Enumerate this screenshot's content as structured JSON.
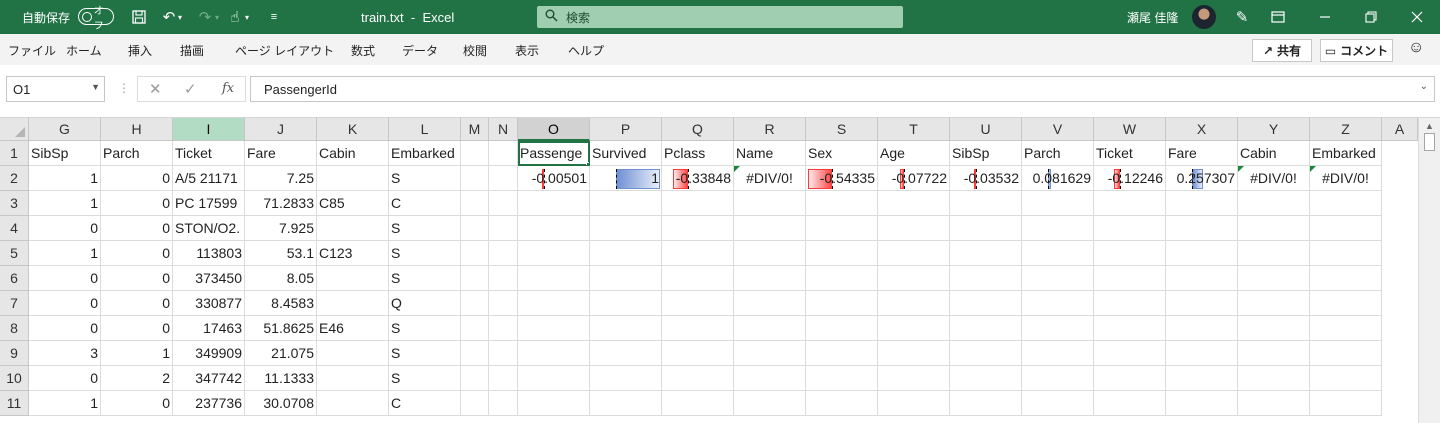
{
  "titlebar": {
    "autosave_label": "自動保存",
    "autosave_state": "オフ",
    "filename": "train.txt",
    "separator": "-",
    "app_name": "Excel",
    "search_placeholder": "検索",
    "user_name": "瀬尾 佳隆",
    "accent_color": "#217346"
  },
  "menu": {
    "items": [
      "ファイル",
      "ホーム",
      "挿入",
      "描画",
      "ページ レイアウト",
      "数式",
      "データ",
      "校閲",
      "表示",
      "ヘルプ"
    ],
    "share_label": "共有",
    "comment_label": "コメント"
  },
  "formula_bar": {
    "name_box": "O1",
    "fx_label": "fx",
    "formula": "PassengerId"
  },
  "sheet": {
    "columns": [
      "G",
      "H",
      "I",
      "J",
      "K",
      "L",
      "M",
      "N",
      "O",
      "P",
      "Q",
      "R",
      "S",
      "T",
      "U",
      "V",
      "W",
      "X",
      "Y",
      "Z",
      "A"
    ],
    "rows": [
      "1",
      "2",
      "3",
      "4",
      "5",
      "6",
      "7",
      "8",
      "9",
      "10",
      "11"
    ],
    "cells": [
      [
        "SibSp",
        "Parch",
        "Ticket",
        "Fare",
        "Cabin",
        "Embarked",
        "",
        "",
        "Passenge",
        "Survived",
        "Pclass",
        "Name",
        "Sex",
        "Age",
        "SibSp",
        "Parch",
        "Ticket",
        "Fare",
        "Cabin",
        "Embarked"
      ],
      [
        "1",
        "0",
        "A/5 21171",
        "7.25",
        "",
        "S",
        "",
        "",
        "-0.00501",
        "1",
        "-0.33848",
        "#DIV/0!",
        "-0.54335",
        "-0.07722",
        "-0.03532",
        "0.081629",
        "-0.12246",
        "0.257307",
        "#DIV/0!",
        "#DIV/0!"
      ],
      [
        "1",
        "0",
        "PC 17599",
        "71.2833",
        "C85",
        "C",
        "",
        "",
        "",
        "",
        "",
        "",
        "",
        "",
        "",
        "",
        "",
        "",
        "",
        ""
      ],
      [
        "0",
        "0",
        "STON/O2.",
        "7.925",
        "",
        "S",
        "",
        "",
        "",
        "",
        "",
        "",
        "",
        "",
        "",
        "",
        "",
        "",
        "",
        ""
      ],
      [
        "1",
        "0",
        "113803",
        "53.1",
        "C123",
        "S",
        "",
        "",
        "",
        "",
        "",
        "",
        "",
        "",
        "",
        "",
        "",
        "",
        "",
        ""
      ],
      [
        "0",
        "0",
        "373450",
        "8.05",
        "",
        "S",
        "",
        "",
        "",
        "",
        "",
        "",
        "",
        "",
        "",
        "",
        "",
        "",
        "",
        ""
      ],
      [
        "0",
        "0",
        "330877",
        "8.4583",
        "",
        "Q",
        "",
        "",
        "",
        "",
        "",
        "",
        "",
        "",
        "",
        "",
        "",
        "",
        "",
        ""
      ],
      [
        "0",
        "0",
        "17463",
        "51.8625",
        "E46",
        "S",
        "",
        "",
        "",
        "",
        "",
        "",
        "",
        "",
        "",
        "",
        "",
        "",
        "",
        ""
      ],
      [
        "3",
        "1",
        "349909",
        "21.075",
        "",
        "S",
        "",
        "",
        "",
        "",
        "",
        "",
        "",
        "",
        "",
        "",
        "",
        "",
        "",
        ""
      ],
      [
        "0",
        "2",
        "347742",
        "11.1333",
        "",
        "S",
        "",
        "",
        "",
        "",
        "",
        "",
        "",
        "",
        "",
        "",
        "",
        "",
        "",
        ""
      ],
      [
        "1",
        "0",
        "237736",
        "30.0708",
        "",
        "C",
        "",
        "",
        "",
        "",
        "",
        "",
        "",
        "",
        "",
        "",
        "",
        "",
        "",
        ""
      ]
    ],
    "selected_column": "O",
    "highlighted_column": "I",
    "active_cell": "O1",
    "databar_colors": {
      "positive": "#6f90d3",
      "negative": "#ff4a4a"
    },
    "error_indicator_color": "#1a8a3a"
  }
}
